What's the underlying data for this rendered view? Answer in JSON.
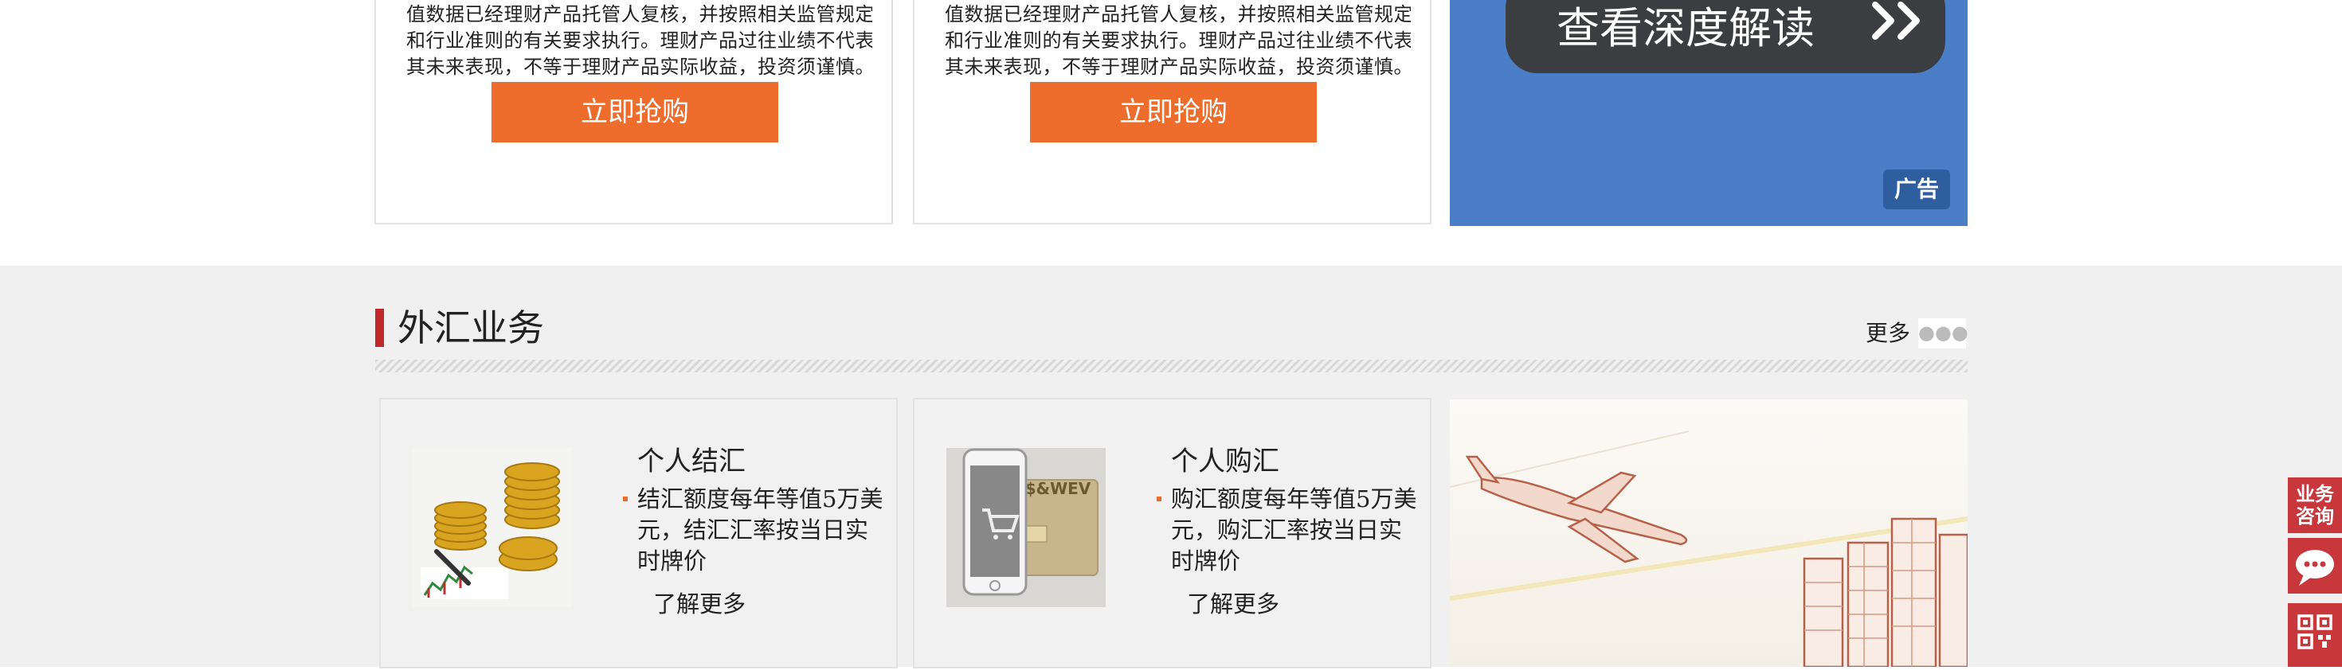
{
  "products": [
    {
      "disclaimer_lines": [
        "值数据已经理财产品托管人复核，并按照相关监管规定",
        "和行业准则的有关要求执行。理财产品过往业绩不代表",
        "其未来表现，不等于理财产品实际收益，投资须谨慎。"
      ],
      "button": "立即抢购"
    },
    {
      "disclaimer_lines": [
        "值数据已经理财产品托管人复核，并按照相关监管规定",
        "和行业准则的有关要求执行。理财产品过往业绩不代表",
        "其未来表现，不等于理财产品实际收益，投资须谨慎。"
      ],
      "button": "立即抢购"
    }
  ],
  "ad": {
    "headline": "查看深度解读",
    "tag": "广告",
    "colors": {
      "background": "#4a7fc8",
      "pill": "#3b3d40",
      "tag": "#2f5ea0"
    }
  },
  "forex": {
    "title": "外汇业务",
    "more": "更多",
    "cards": [
      {
        "title": "个人结汇",
        "desc": "结汇额度每年等值5万美元，结汇汇率按当日实时牌价",
        "link": "了解更多",
        "icon": "gold-coins-image"
      },
      {
        "title": "个人购汇",
        "desc": "购汇额度每年等值5万美元，购汇汇率按当日实时牌价",
        "link": "了解更多",
        "icon": "phone-card-image",
        "card_text": "$&WEV"
      }
    ]
  },
  "sidebar": {
    "consult_line1": "业务",
    "consult_line2": "咨询"
  },
  "colors": {
    "accent_orange": "#ee6c2c",
    "title_bar_red": "#c0282c",
    "sidebar_red": "#c8373c",
    "band_gray": "#f0f0f0"
  }
}
